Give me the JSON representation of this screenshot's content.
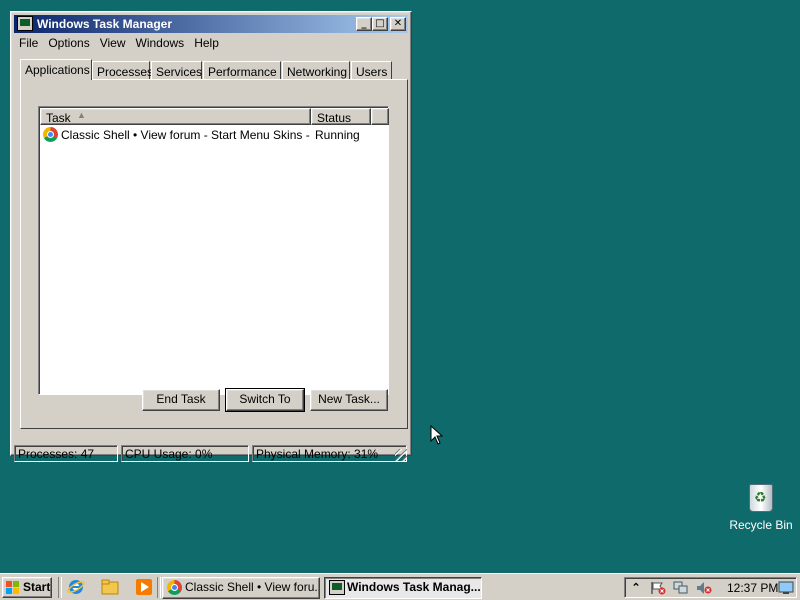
{
  "window": {
    "title": "Windows Task Manager",
    "menu": [
      "File",
      "Options",
      "View",
      "Windows",
      "Help"
    ],
    "tabs": [
      "Applications",
      "Processes",
      "Services",
      "Performance",
      "Networking",
      "Users"
    ],
    "active_tab": "Applications",
    "list": {
      "columns": [
        "Task",
        "Status"
      ],
      "rows": [
        {
          "task": "Classic Shell • View forum - Start Menu Skins - Go...",
          "status": "Running",
          "icon": "chrome-icon"
        }
      ]
    },
    "buttons": {
      "end_task": "End Task",
      "switch_to": "Switch To",
      "new_task": "New Task..."
    },
    "status": {
      "processes": "Processes: 47",
      "cpu": "CPU Usage: 0%",
      "memory": "Physical Memory: 31%"
    }
  },
  "desktop": {
    "recycle_bin": "Recycle Bin"
  },
  "taskbar": {
    "start": "Start",
    "tasks": [
      {
        "label": "Classic Shell • View foru...",
        "icon": "chrome-icon"
      },
      {
        "label": "Windows Task Manag...",
        "icon": "task-manager-icon"
      }
    ],
    "clock": "12:37 PM"
  },
  "colors": {
    "desktop": "#0f6b6b",
    "title_start": "#0a246a",
    "title_end": "#a6caf0",
    "face": "#d4d0c8"
  }
}
